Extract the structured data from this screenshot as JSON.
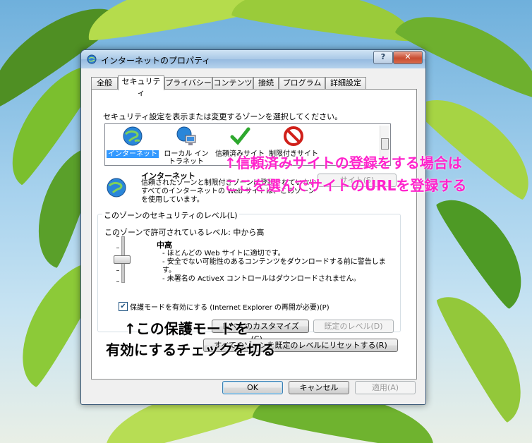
{
  "window": {
    "title": "インターネットのプロパティ",
    "help_glyph": "?",
    "close_glyph": "✕"
  },
  "tabs": [
    {
      "label": "全般"
    },
    {
      "label": "セキュリティ"
    },
    {
      "label": "プライバシー"
    },
    {
      "label": "コンテンツ"
    },
    {
      "label": "接続"
    },
    {
      "label": "プログラム"
    },
    {
      "label": "詳細設定"
    }
  ],
  "security": {
    "instruction": "セキュリティ設定を表示または変更するゾーンを選択してください。",
    "zones": [
      {
        "label": "インターネット",
        "icon": "globe-icon",
        "selected": true
      },
      {
        "label": "ローカル イントラネット",
        "icon": "intranet-icon",
        "selected": false
      },
      {
        "label": "信頼済みサイト",
        "icon": "check-icon",
        "selected": false
      },
      {
        "label": "制限付きサイト",
        "icon": "restricted-icon",
        "selected": false
      }
    ],
    "zone_detail": {
      "name": "インターネット",
      "description": "信頼されたゾーンと制限付きゾーンに登録されていないすべてのインターネットの Web サイトは、このゾーンを使用しています。",
      "sites_button": "サイト(S)"
    },
    "level_group": {
      "title": "このゾーンのセキュリティのレベル(L)",
      "allowed": "このゾーンで許可されているレベル: 中から高",
      "level_name": "中高",
      "bullets": [
        "- ほとんどの Web サイトに適切です。",
        "- 安全でない可能性のあるコンテンツをダウンロードする前に警告します。",
        "- 未署名の ActiveX コントロールはダウンロードされません。"
      ],
      "protected_mode_label": "保護モードを有効にする (Internet Explorer の再開が必要)(P)",
      "protected_mode_checked": true,
      "custom_level_button": "レベルのカスタマイズ(C)...",
      "default_level_button": "既定のレベル(D)"
    },
    "reset_all_button": "すべてのゾーンを既定のレベルにリセットする(R)"
  },
  "footer": {
    "ok": "OK",
    "cancel": "キャンセル",
    "apply": "適用(A)"
  },
  "annotations": {
    "trusted_sites_line1": "↑信頼済みサイトの登録をする場合は",
    "trusted_sites_line2": "ここを選んでサイトのURLを登録する",
    "protected_mode_line1": "↑この保護モードを",
    "protected_mode_line2": "有効にするチェックを切る"
  },
  "colors": {
    "annotation_pink": "#ff22cc",
    "selection": "#3399ff"
  }
}
